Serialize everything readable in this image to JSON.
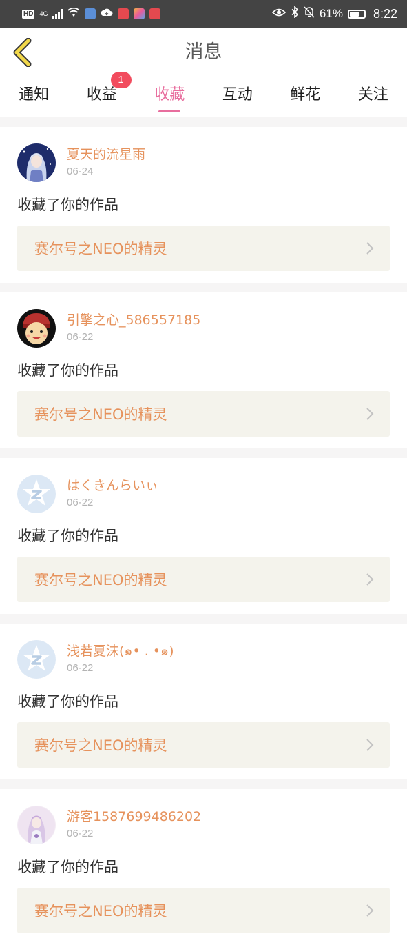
{
  "status_bar": {
    "hd": "HD",
    "network": "4G",
    "battery": "61%",
    "battery_level": 0.61,
    "time": "8:22"
  },
  "header": {
    "title": "消息"
  },
  "tabs": [
    {
      "label": "通知"
    },
    {
      "label": "收益",
      "badge": "1"
    },
    {
      "label": "收藏",
      "active": true
    },
    {
      "label": "互动"
    },
    {
      "label": "鲜花"
    },
    {
      "label": "关注"
    }
  ],
  "messages": [
    {
      "name": "夏天的流星雨",
      "date": "06-24",
      "action": "收藏了你的作品",
      "work": "赛尔号之NEO的精灵",
      "avatar": "anime-girl-blue"
    },
    {
      "name": "引擎之心_586557185",
      "date": "06-22",
      "action": "收藏了你的作品",
      "work": "赛尔号之NEO的精灵",
      "avatar": "cartoon-boy-cap"
    },
    {
      "name": "はくきんらいぃ",
      "date": "06-22",
      "action": "收藏了你的作品",
      "work": "赛尔号之NEO的精灵",
      "avatar": "default-star"
    },
    {
      "name": "浅若夏沫(๑• . •๑)",
      "date": "06-22",
      "action": "收藏了你的作品",
      "work": "赛尔号之NEO的精灵",
      "avatar": "default-star"
    },
    {
      "name": "游客1587699486202",
      "date": "06-22",
      "action": "收藏了你的作品",
      "work": "赛尔号之NEO的精灵",
      "avatar": "anime-girl-lilac"
    }
  ],
  "colors": {
    "accent_pink": "#e86e9e",
    "name_orange": "#e6925c",
    "badge_red": "#f24c5e",
    "back_yellow": "#f2d84a"
  }
}
